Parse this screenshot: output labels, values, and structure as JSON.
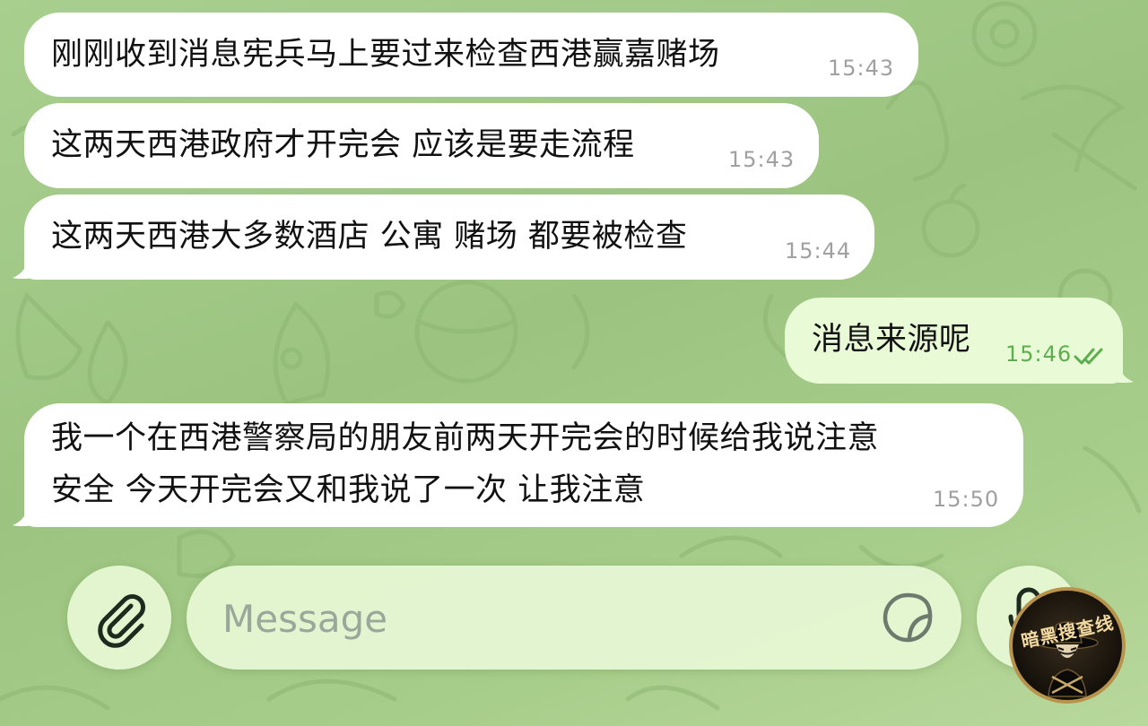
{
  "messages": [
    {
      "direction": "incoming",
      "text": "刚刚收到消息宪兵马上要过来检查西港赢嘉赌场",
      "time": "15:43"
    },
    {
      "direction": "incoming",
      "text": "这两天西港政府才开完会 应该是要走流程",
      "time": "15:43"
    },
    {
      "direction": "incoming",
      "text": "这两天西港大多数酒店 公寓 赌场 都要被检查",
      "time": "15:44"
    },
    {
      "direction": "outgoing",
      "text": "消息来源呢",
      "time": "15:46",
      "status": "read"
    },
    {
      "direction": "incoming",
      "text": "我一个在西港警察局的朋友前两天开完会的时候给我说注意\n安全 今天开完会又和我说了一次 让我注意",
      "time": "15:50"
    }
  ],
  "composer": {
    "placeholder": "Message",
    "attach_icon": "paperclip-icon",
    "sticker_icon": "sticker-icon",
    "mic_icon": "microphone-icon"
  },
  "watermark": {
    "text": "暗黑搜查线",
    "icon": "masked-figure-logo"
  },
  "colors": {
    "incoming_bubble": "#ffffff",
    "outgoing_bubble": "#e9fbd6",
    "outgoing_time": "#5cae4f",
    "incoming_time": "#a0a0a0",
    "background": "#a3ca87"
  }
}
